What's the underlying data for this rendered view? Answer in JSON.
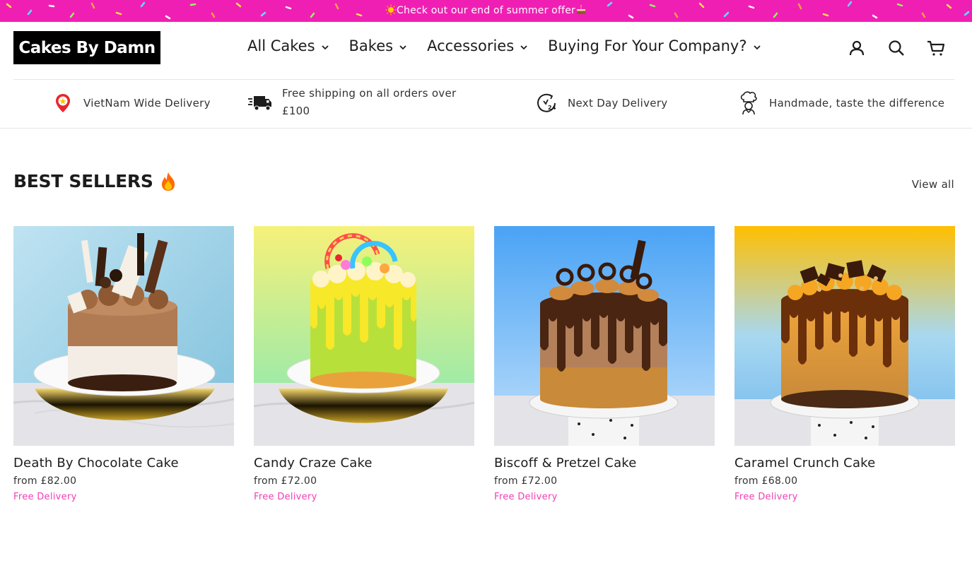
{
  "announcement": {
    "text": "Check out our end of summer offer"
  },
  "header": {
    "logo": "Cakes By Damn",
    "nav": [
      {
        "label": "All Cakes"
      },
      {
        "label": "Bakes"
      },
      {
        "label": "Accessories"
      },
      {
        "label": "Buying For Your Company?"
      }
    ],
    "icons": [
      "account-icon",
      "search-icon",
      "cart-icon"
    ]
  },
  "benefits": [
    {
      "icon": "map-pin-icon",
      "text": "VietNam Wide Delivery"
    },
    {
      "icon": "delivery-truck-icon",
      "text_line1": "Free shipping on all orders over",
      "text_line2": "£100"
    },
    {
      "icon": "clock-24-icon",
      "text": "Next Day Delivery"
    },
    {
      "icon": "chef-icon",
      "text": "Handmade, taste the difference"
    }
  ],
  "best_sellers": {
    "title": "BEST SELLERS",
    "view_all": "View all",
    "products": [
      {
        "name": "Death By Chocolate Cake",
        "price": "from £82.00",
        "delivery": "Free Delivery"
      },
      {
        "name": "Candy Craze Cake",
        "price": "from £72.00",
        "delivery": "Free Delivery"
      },
      {
        "name": "Biscoff & Pretzel Cake",
        "price": "from £72.00",
        "delivery": "Free Delivery"
      },
      {
        "name": "Caramel Crunch Cake",
        "price": "from £68.00",
        "delivery": "Free Delivery"
      }
    ]
  },
  "colors": {
    "accent_pink": "#f01fb4",
    "delivery_pink": "#f03fb5",
    "text": "#1c1c1c"
  }
}
